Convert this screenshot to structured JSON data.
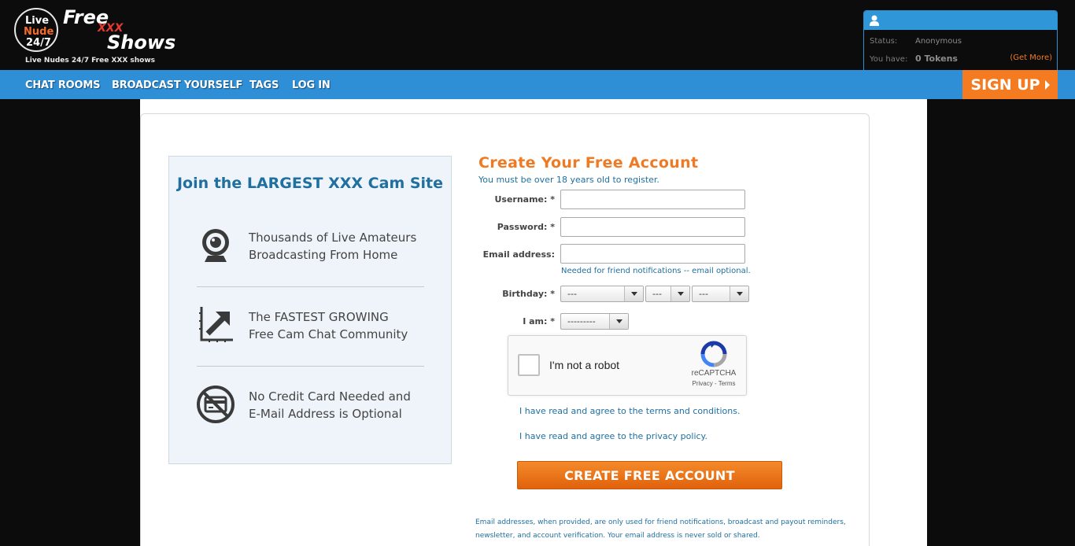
{
  "header": {
    "logo": {
      "live": "Live",
      "nude": "Nude",
      "hours": "24/7",
      "free": "Free",
      "xxx": "XXX",
      "shows": "Shows"
    },
    "tagline": "Live Nudes 24/7 Free XXX shows"
  },
  "user_panel": {
    "status_label": "Status:",
    "status_value": "Anonymous",
    "tokens_label": "You have:",
    "tokens_value": "0 Tokens",
    "get_more": "(Get More)"
  },
  "nav": {
    "items": [
      {
        "label": "CHAT ROOMS"
      },
      {
        "label": "BROADCAST YOURSELF"
      },
      {
        "label": "TAGS"
      },
      {
        "label": "LOG IN"
      }
    ],
    "signup": "SIGN UP"
  },
  "promo": {
    "title": "Join the LARGEST XXX Cam Site",
    "features": [
      {
        "icon": "webcam-icon",
        "line1": "Thousands of Live Amateurs",
        "line2": "Broadcasting From Home"
      },
      {
        "icon": "growth-arrow-icon",
        "line1": "The FASTEST GROWING",
        "line2": "Free Cam Chat Community"
      },
      {
        "icon": "no-credit-card-icon",
        "line1": "No Credit Card Needed and",
        "line2": "E-Mail Address is Optional"
      }
    ]
  },
  "form": {
    "title": "Create Your Free Account",
    "subtitle": "You must be over 18 years old to register.",
    "username_label": "Username: *",
    "username_value": "",
    "password_label": "Password: *",
    "password_value": "",
    "email_label": "Email address:",
    "email_value": "",
    "email_hint": "Needed for friend notifications -- email optional.",
    "birthday_label": "Birthday: *",
    "birthday_month": "---",
    "birthday_day": "---",
    "birthday_year": "---",
    "gender_label": "I am: *",
    "gender_value": "---------",
    "terms": "I have read and agree to the terms and conditions.",
    "privacy": "I have read and agree to the privacy policy.",
    "submit": "CREATE FREE ACCOUNT",
    "fineprint": "Email addresses, when provided, are only used for friend notifications, broadcast and payout reminders, newsletter, and account verification. Your email address is never sold or shared."
  },
  "recaptcha": {
    "label": "I'm not a robot",
    "brand": "reCAPTCHA",
    "links": "Privacy - Terms"
  },
  "colors": {
    "nav_blue": "#2f8fd6",
    "accent_orange": "#f47b20",
    "link_blue": "#1f6fa0",
    "promo_bg": "#eef4f9"
  }
}
